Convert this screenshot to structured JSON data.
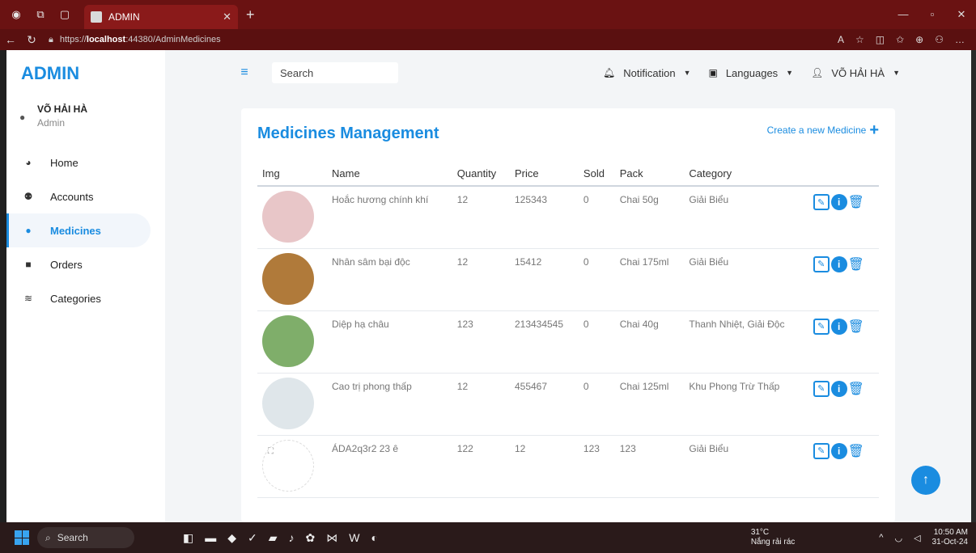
{
  "browser": {
    "tab_title": "ADMIN",
    "url_prefix": "https://",
    "url_host": "localhost",
    "url_rest": ":44380/AdminMedicines"
  },
  "sidebar": {
    "brand": "ADMIN",
    "user_name": "VÕ HẢI HÀ",
    "user_role": "Admin",
    "items": [
      {
        "label": "Home",
        "icon": "dashboard-icon"
      },
      {
        "label": "Accounts",
        "icon": "users-icon"
      },
      {
        "label": "Medicines",
        "icon": "pills-icon",
        "active": true
      },
      {
        "label": "Orders",
        "icon": "box-icon"
      },
      {
        "label": "Categories",
        "icon": "layers-icon"
      }
    ]
  },
  "topbar": {
    "search_placeholder": "Search",
    "notification": "Notification",
    "languages": "Languages",
    "user": "VÕ HẢI HÀ"
  },
  "main": {
    "title": "Medicines Management",
    "create_label": "Create a new Medicine",
    "columns": [
      "Img",
      "Name",
      "Quantity",
      "Price",
      "Sold",
      "Pack",
      "Category"
    ],
    "rows": [
      {
        "name": "Hoắc hương chính khí",
        "quantity": "12",
        "price": "125343",
        "sold": "0",
        "pack": "Chai 50g",
        "category": "Giải Biểu",
        "thumb": "#e8c6c8"
      },
      {
        "name": "Nhân sâm bại độc",
        "quantity": "12",
        "price": "15412",
        "sold": "0",
        "pack": "Chai 175ml",
        "category": "Giải Biểu",
        "thumb": "#b07a3a"
      },
      {
        "name": "Diệp hạ châu",
        "quantity": "123",
        "price": "213434545",
        "sold": "0",
        "pack": "Chai 40g",
        "category": "Thanh Nhiệt, Giải Độc",
        "thumb": "#7fae6a"
      },
      {
        "name": "Cao trị phong thấp",
        "quantity": "12",
        "price": "455467",
        "sold": "0",
        "pack": "Chai 125ml",
        "category": "Khu Phong Trừ Thấp",
        "thumb": "#dfe6ea"
      },
      {
        "name": "ÁDA2q3r2 23 ê",
        "quantity": "122",
        "price": "12",
        "sold": "123",
        "pack": "123",
        "category": "Giải Biểu",
        "thumb": ""
      }
    ]
  },
  "taskbar": {
    "search": "Search",
    "temp": "31°C",
    "weather": "Nắng rải rác",
    "time": "10:50 AM",
    "date": "31-Oct-24"
  },
  "colors": {
    "accent": "#1a8ce0",
    "browser": "#6a1212"
  }
}
